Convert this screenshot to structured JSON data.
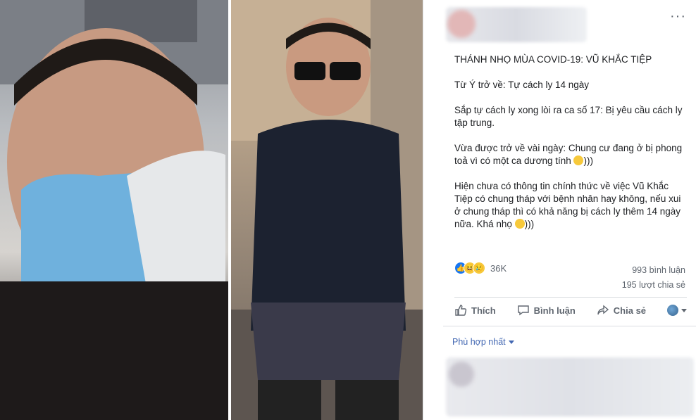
{
  "post": {
    "title": "THÁNH NHỌ MÙA COVID-19: VŨ KHẮC TIỆP",
    "line1": "Từ Ý trở về: Tự cách ly 14 ngày",
    "line2": "Sắp tự cách ly xong lòi ra ca số 17: Bị yêu cầu cách ly tập trung.",
    "line3_text": "Vừa được trở về vài ngày: Chung cư đang ở bị phong toả vì có một ca dương tính ",
    "line3_tail": ")))",
    "line4_text": "Hiện chưa có thông tin chính thức về việc Vũ Khắc Tiệp có chung tháp với bệnh nhân hay không, nếu xui ở chung tháp thì có khả năng bị cách ly thêm 14 ngày nữa. Khá nhọ ",
    "line4_tail": ")))"
  },
  "stats": {
    "reactions_count": "36K",
    "comments": "993 bình luận",
    "shares": "195 lượt chia sẻ"
  },
  "actions": {
    "like": "Thích",
    "comment": "Bình luận",
    "share": "Chia sẻ"
  },
  "sort": {
    "label": "Phù hợp nhất"
  },
  "more_label": "···",
  "icons": {
    "like": "like-icon",
    "comment": "comment-icon",
    "share": "share-icon",
    "globe": "globe-icon"
  }
}
